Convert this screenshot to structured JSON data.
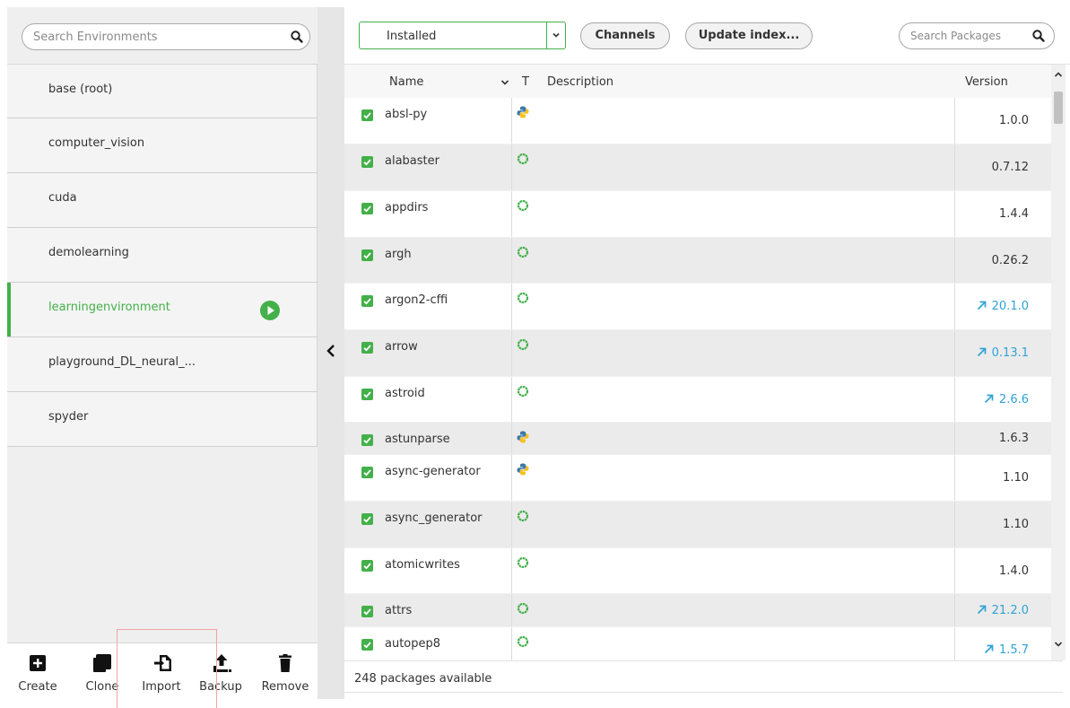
{
  "environments": {
    "search_placeholder": "Search Environments",
    "items": [
      {
        "name": "base (root)",
        "active": false
      },
      {
        "name": "computer_vision",
        "active": false
      },
      {
        "name": "cuda",
        "active": false
      },
      {
        "name": "demolearning",
        "active": false
      },
      {
        "name": "learningenvironment",
        "active": true
      },
      {
        "name": "playground_DL_neural_...",
        "active": false
      },
      {
        "name": "spyder",
        "active": false
      }
    ],
    "actions": {
      "create": "Create",
      "clone": "Clone",
      "import": "Import",
      "backup": "Backup",
      "remove": "Remove"
    }
  },
  "toolbar": {
    "filter_value": "Installed",
    "channels_label": "Channels",
    "update_index_label": "Update index...",
    "search_placeholder": "Search Packages"
  },
  "table": {
    "headers": {
      "name": "Name",
      "type": "T",
      "description": "Description",
      "version": "Version"
    },
    "rows": [
      {
        "name": "absl-py",
        "type": "python",
        "description": "",
        "version": "1.0.0",
        "update": false
      },
      {
        "name": "alabaster",
        "type": "conda",
        "description": "",
        "version": "0.7.12",
        "update": false
      },
      {
        "name": "appdirs",
        "type": "conda",
        "description": "",
        "version": "1.4.4",
        "update": false
      },
      {
        "name": "argh",
        "type": "conda",
        "description": "",
        "version": "0.26.2",
        "update": false
      },
      {
        "name": "argon2-cffi",
        "type": "conda",
        "description": "",
        "version": "20.1.0",
        "update": true
      },
      {
        "name": "arrow",
        "type": "conda",
        "description": "",
        "version": "0.13.1",
        "update": true
      },
      {
        "name": "astroid",
        "type": "conda",
        "description": "",
        "version": "2.6.6",
        "update": true
      },
      {
        "name": "astunparse",
        "type": "python",
        "description": "",
        "version": "1.6.3",
        "update": false
      },
      {
        "name": "async-generator",
        "type": "python",
        "description": "",
        "version": "1.10",
        "update": false
      },
      {
        "name": "async_generator",
        "type": "conda",
        "description": "",
        "version": "1.10",
        "update": false
      },
      {
        "name": "atomicwrites",
        "type": "conda",
        "description": "",
        "version": "1.4.0",
        "update": false
      },
      {
        "name": "attrs",
        "type": "conda",
        "description": "",
        "version": "21.2.0",
        "update": true
      },
      {
        "name": "autopep8",
        "type": "conda",
        "description": "",
        "version": "1.5.7",
        "update": true
      }
    ]
  },
  "status": {
    "packages_available": "248 packages available"
  },
  "colors": {
    "accent_green": "#43b049",
    "update_blue": "#2ea3d6",
    "python_blue": "#3b78aa",
    "python_yellow": "#f5c125"
  }
}
